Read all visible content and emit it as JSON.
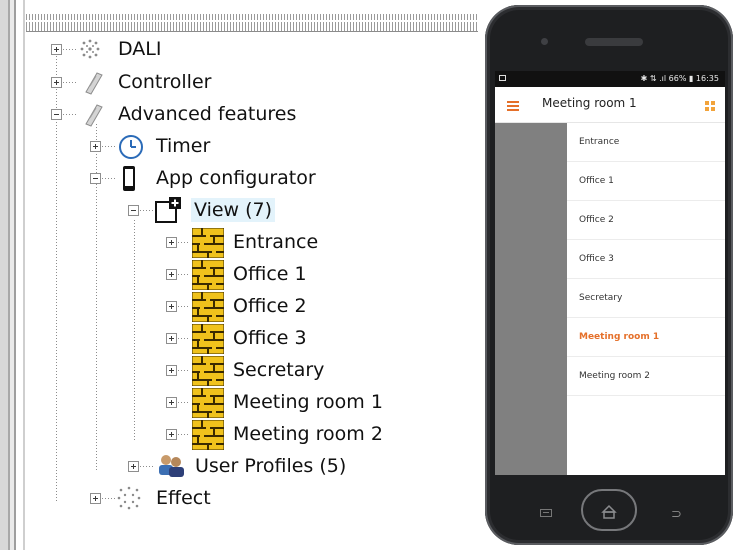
{
  "tree": {
    "items": {
      "dali": "DALI",
      "controller": "Controller",
      "advanced": "Advanced features",
      "timer": "Timer",
      "app_configurator": "App configurator",
      "view": "View (7)",
      "entrance": "Entrance",
      "office1": "Office 1",
      "office2": "Office 2",
      "office3": "Office 3",
      "secretary": "Secretary",
      "meeting1": "Meeting room 1",
      "meeting2": "Meeting room 2",
      "user_profiles": "User Profiles (5)",
      "effect": "Effect"
    }
  },
  "phone": {
    "status_right": "✱ ⇅ .ıl 66% ▮ 16:35",
    "title": "Meeting room 1",
    "rooms": [
      "Entrance",
      "Office 1",
      "Office 2",
      "Office 3",
      "Secretary",
      "Meeting room 1",
      "Meeting room 2"
    ],
    "active_room": "Meeting room 1",
    "accent_color": "#e5702a"
  }
}
